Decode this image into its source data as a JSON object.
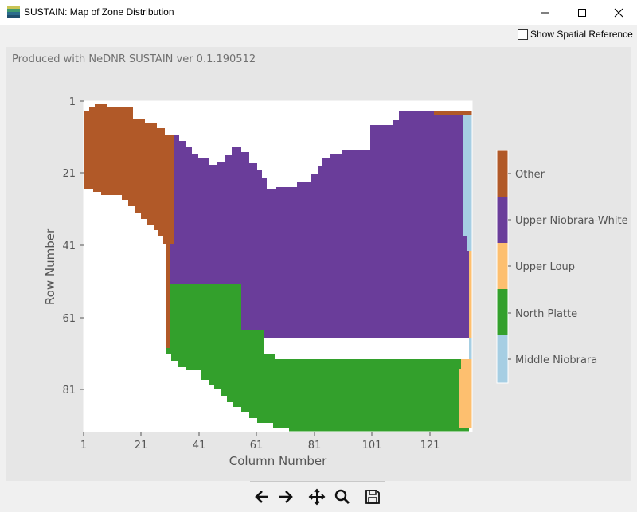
{
  "window": {
    "title": "SUSTAIN: Map of Zone Distribution",
    "controls": [
      "minimize",
      "maximize",
      "close"
    ]
  },
  "options": {
    "show_spatial_reference_label": "Show Spatial Reference",
    "show_spatial_reference_checked": false
  },
  "figure": {
    "produced_with": "Produced with NeDNR SUSTAIN ver 0.1.190512"
  },
  "chart_data": {
    "type": "heatmap",
    "xlabel": "Column Number",
    "ylabel": "Row Number",
    "x_ticks": [
      "1",
      "21",
      "41",
      "61",
      "81",
      "101",
      "121"
    ],
    "y_ticks": [
      "1",
      "21",
      "41",
      "61",
      "81"
    ],
    "xlim": [
      1,
      135
    ],
    "ylim": [
      1,
      92
    ],
    "colorbar": [
      {
        "name": "Other",
        "color": "#b15928"
      },
      {
        "name": "Upper Niobrara-White",
        "color": "#6a3d9a"
      },
      {
        "name": "Upper Loup",
        "color": "#fdbf6f"
      },
      {
        "name": "North Platte",
        "color": "#33a02c"
      },
      {
        "name": "Middle Niobrara",
        "color": "#a6cee3"
      }
    ]
  },
  "nav_toolbar": {
    "buttons": [
      {
        "name": "back",
        "icon": "arrow-left-icon"
      },
      {
        "name": "forward",
        "icon": "arrow-right-icon"
      },
      {
        "name": "pan",
        "icon": "pan-icon"
      },
      {
        "name": "zoom",
        "icon": "zoom-icon"
      },
      {
        "name": "save",
        "icon": "save-icon"
      }
    ]
  }
}
